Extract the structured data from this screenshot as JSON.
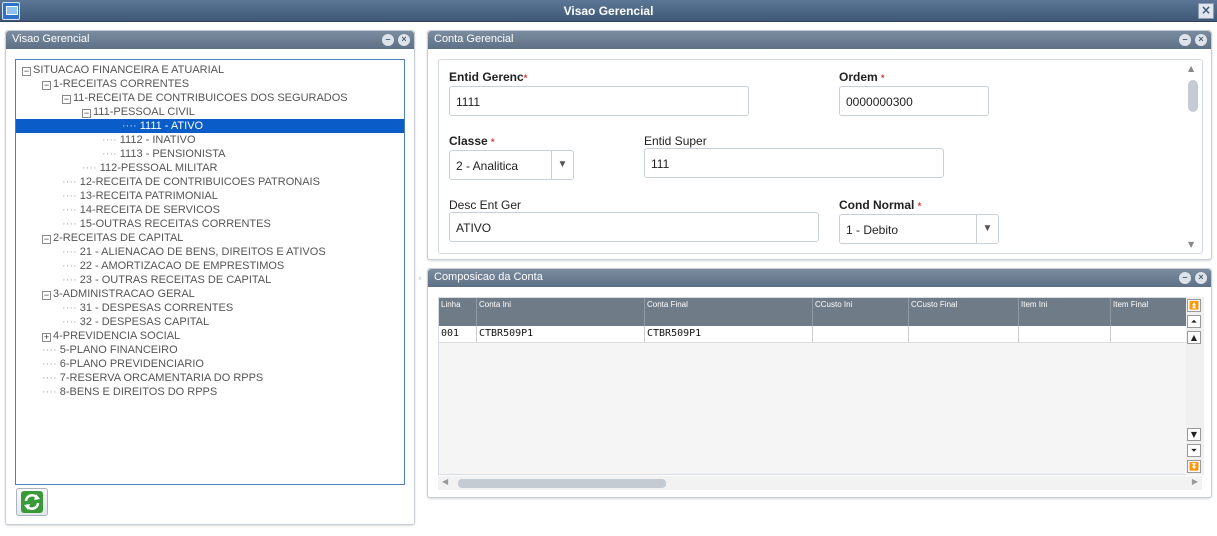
{
  "window": {
    "title": "Visao Gerencial",
    "close": "×"
  },
  "left_panel": {
    "title": "Visao Gerencial",
    "minimize": "–",
    "close": "×",
    "tree": [
      {
        "label": "SITUACAO FINANCEIRA E ATUARIAL",
        "level": 0,
        "expander": "−"
      },
      {
        "label": "1-RECEITAS CORRENTES",
        "level": 1,
        "expander": "−"
      },
      {
        "label": "11-RECEITA DE CONTRIBUICOES DOS SEGURADOS",
        "level": 2,
        "expander": "−"
      },
      {
        "label": "111-PESSOAL CIVIL",
        "level": 3,
        "expander": "−"
      },
      {
        "label": "1111 - ATIVO",
        "level": 4,
        "expander": "",
        "selected": true
      },
      {
        "label": "1112 - INATIVO",
        "level": 4,
        "expander": ""
      },
      {
        "label": "1113 - PENSIONISTA",
        "level": 4,
        "expander": ""
      },
      {
        "label": "112-PESSOAL MILITAR",
        "level": 3,
        "expander": ""
      },
      {
        "label": "12-RECEITA DE CONTRIBUICOES PATRONAIS",
        "level": 2,
        "expander": ""
      },
      {
        "label": "13-RECEITA PATRIMONIAL",
        "level": 2,
        "expander": ""
      },
      {
        "label": "14-RECEITA DE SERVICOS",
        "level": 2,
        "expander": ""
      },
      {
        "label": "15-OUTRAS RECEITAS CORRENTES",
        "level": 2,
        "expander": ""
      },
      {
        "label": "2-RECEITAS DE CAPITAL",
        "level": 1,
        "expander": "−"
      },
      {
        "label": "21 - ALIENACAO DE BENS, DIREITOS E ATIVOS",
        "level": 2,
        "expander": ""
      },
      {
        "label": "22 - AMORTIZACAO DE EMPRESTIMOS",
        "level": 2,
        "expander": ""
      },
      {
        "label": "23 - OUTRAS RECEITAS DE CAPITAL",
        "level": 2,
        "expander": ""
      },
      {
        "label": "3-ADMINISTRACAO GERAL",
        "level": 1,
        "expander": "−"
      },
      {
        "label": "31 - DESPESAS CORRENTES",
        "level": 2,
        "expander": ""
      },
      {
        "label": "32 - DESPESAS CAPITAL",
        "level": 2,
        "expander": ""
      },
      {
        "label": "4-PREVIDENCIA SOCIAL",
        "level": 1,
        "expander": "+"
      },
      {
        "label": "5-PLANO FINANCEIRO",
        "level": 1,
        "expander": ""
      },
      {
        "label": "6-PLANO PREVIDENCIARIO",
        "level": 1,
        "expander": ""
      },
      {
        "label": "7-RESERVA ORCAMENTARIA DO RPPS",
        "level": 1,
        "expander": ""
      },
      {
        "label": "8-BENS E DIREITOS DO RPPS",
        "level": 1,
        "expander": ""
      }
    ]
  },
  "conta_panel": {
    "title": "Conta Gerencial",
    "minimize": "–",
    "close": "×",
    "required_mark": "*",
    "fields": {
      "entid_gerenc": {
        "label": "Entid Gerenc",
        "value": "1111"
      },
      "ordem": {
        "label": "Ordem",
        "value": "0000000300"
      },
      "classe": {
        "label": "Classe",
        "value": "2 - Analitica"
      },
      "entid_super": {
        "label": "Entid Super",
        "value": "111"
      },
      "desc_ent_ger": {
        "label": "Desc Ent Ger",
        "value": "ATIVO"
      },
      "cond_normal": {
        "label": "Cond Normal",
        "value": "1 - Debito"
      }
    }
  },
  "composicao_panel": {
    "title": "Composicao da Conta",
    "minimize": "–",
    "close": "×",
    "columns": [
      "Linha",
      "Conta Ini",
      "Conta Final",
      "CCusto Ini",
      "CCusto Final",
      "Item Ini",
      "Item Final"
    ],
    "rows": [
      [
        "001",
        "CTBR509P1",
        "CTBR509P1",
        "",
        "",
        "",
        ""
      ]
    ]
  },
  "colors": {
    "accent": "#0a5cc8",
    "header": "#5e7086",
    "grid_header": "#6f7c88"
  }
}
